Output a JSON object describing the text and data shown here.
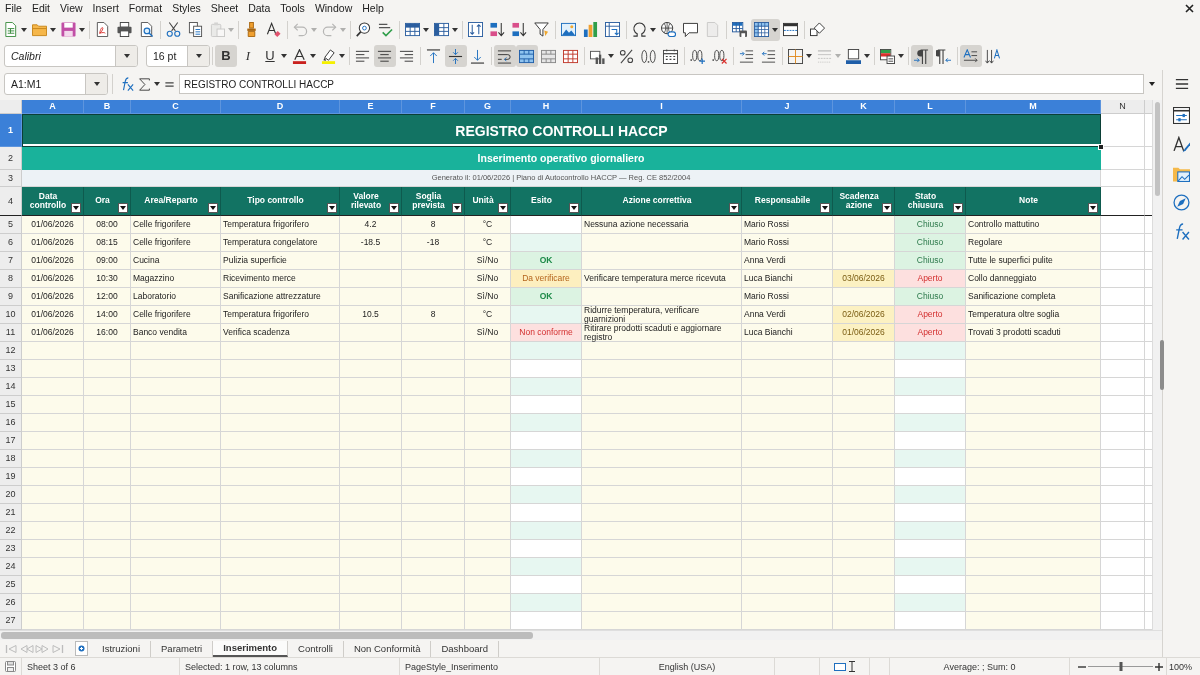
{
  "menu_bar": [
    "File",
    "Edit",
    "View",
    "Insert",
    "Format",
    "Styles",
    "Sheet",
    "Data",
    "Tools",
    "Window",
    "Help"
  ],
  "standard_toolbar": {
    "groups": [
      [
        {
          "kind": "new",
          "dropdown": true,
          "pressed": false,
          "disabled": false
        },
        {
          "kind": "open",
          "dropdown": true,
          "pressed": false,
          "disabled": false
        },
        {
          "kind": "save",
          "dropdown": true,
          "pressed": false,
          "disabled": false
        }
      ],
      [
        {
          "kind": "export_pdf",
          "dropdown": false,
          "pressed": false,
          "disabled": false
        },
        {
          "kind": "print",
          "dropdown": false,
          "pressed": false,
          "disabled": false
        },
        {
          "kind": "print_preview",
          "dropdown": false,
          "pressed": false,
          "disabled": false
        }
      ],
      [
        {
          "kind": "cut",
          "dropdown": false,
          "pressed": false,
          "disabled": false
        },
        {
          "kind": "copy",
          "dropdown": false,
          "pressed": false,
          "disabled": false
        },
        {
          "kind": "paste",
          "dropdown": true,
          "pressed": false,
          "disabled": true
        }
      ],
      [
        {
          "kind": "clone_format",
          "dropdown": false,
          "pressed": false,
          "disabled": false
        },
        {
          "kind": "clear_format",
          "dropdown": false,
          "pressed": false,
          "disabled": false
        }
      ],
      [
        {
          "kind": "undo",
          "dropdown": true,
          "pressed": false,
          "disabled": true
        },
        {
          "kind": "redo",
          "dropdown": true,
          "pressed": false,
          "disabled": true
        }
      ],
      [
        {
          "kind": "find_replace",
          "dropdown": false,
          "pressed": false,
          "disabled": false
        },
        {
          "kind": "spelling",
          "dropdown": false,
          "pressed": false,
          "disabled": false
        }
      ],
      [
        {
          "kind": "rows",
          "dropdown": true,
          "pressed": false,
          "disabled": false
        },
        {
          "kind": "columns",
          "dropdown": true,
          "pressed": false,
          "disabled": false
        }
      ],
      [
        {
          "kind": "sort",
          "dropdown": false,
          "pressed": false,
          "disabled": false
        },
        {
          "kind": "sort_ascending",
          "dropdown": false,
          "pressed": false,
          "disabled": false
        },
        {
          "kind": "sort_descending",
          "dropdown": false,
          "pressed": false,
          "disabled": false
        },
        {
          "kind": "autofilter",
          "dropdown": false,
          "pressed": false,
          "disabled": false
        }
      ],
      [
        {
          "kind": "image",
          "dropdown": false,
          "pressed": false,
          "disabled": false
        },
        {
          "kind": "chart",
          "dropdown": false,
          "pressed": false,
          "disabled": false
        },
        {
          "kind": "pivot_table",
          "dropdown": false,
          "pressed": false,
          "disabled": false
        }
      ],
      [
        {
          "kind": "special_character",
          "dropdown": true,
          "pressed": false,
          "disabled": false
        },
        {
          "kind": "hyperlink",
          "dropdown": false,
          "pressed": false,
          "disabled": false
        },
        {
          "kind": "comment",
          "dropdown": false,
          "pressed": false,
          "disabled": false
        },
        {
          "kind": "header_footer",
          "dropdown": false,
          "pressed": false,
          "disabled": true
        }
      ],
      [
        {
          "kind": "print_area",
          "dropdown": false,
          "pressed": false,
          "disabled": false
        },
        {
          "kind": "freeze",
          "dropdown": true,
          "pressed": true,
          "disabled": false
        },
        {
          "kind": "split_window",
          "dropdown": false,
          "pressed": false,
          "disabled": false
        }
      ],
      [
        {
          "kind": "draw_functions",
          "dropdown": false,
          "pressed": false,
          "disabled": false
        }
      ]
    ]
  },
  "formatting_toolbar": {
    "font_name": "Calibri",
    "font_size": "16 pt",
    "groups": [
      [
        {
          "kind": "bold",
          "label": "B",
          "dropdown": false,
          "pressed": true,
          "disabled": false
        },
        {
          "kind": "italic",
          "label": "I",
          "dropdown": false,
          "pressed": false,
          "disabled": false
        },
        {
          "kind": "underline",
          "label": "U",
          "dropdown": true,
          "pressed": false,
          "disabled": false
        },
        {
          "kind": "font_color",
          "dropdown": true,
          "pressed": false,
          "disabled": false
        },
        {
          "kind": "highlight",
          "dropdown": true,
          "pressed": false,
          "disabled": false
        }
      ],
      [
        {
          "kind": "align_left",
          "dropdown": false,
          "pressed": false,
          "disabled": false
        },
        {
          "kind": "align_center",
          "dropdown": false,
          "pressed": true,
          "disabled": false
        },
        {
          "kind": "align_right",
          "dropdown": false,
          "pressed": false,
          "disabled": false
        }
      ],
      [
        {
          "kind": "align_top",
          "dropdown": false,
          "pressed": false,
          "disabled": false
        },
        {
          "kind": "align_middle",
          "dropdown": false,
          "pressed": true,
          "disabled": false
        },
        {
          "kind": "align_bottom",
          "dropdown": false,
          "pressed": false,
          "disabled": false
        }
      ],
      [
        {
          "kind": "wrap_text",
          "dropdown": false,
          "pressed": true,
          "disabled": false
        },
        {
          "kind": "merge_center",
          "dropdown": false,
          "pressed": true,
          "disabled": false
        },
        {
          "kind": "merge_cells",
          "dropdown": false,
          "pressed": false,
          "disabled": false
        },
        {
          "kind": "unmerge_cells",
          "dropdown": false,
          "pressed": false,
          "disabled": false
        }
      ],
      [
        {
          "kind": "number_format",
          "dropdown": true,
          "pressed": false,
          "disabled": false
        },
        {
          "kind": "percent",
          "dropdown": false,
          "pressed": false,
          "disabled": false
        },
        {
          "kind": "decimal_format",
          "dropdown": false,
          "pressed": false,
          "disabled": false
        },
        {
          "kind": "date_format",
          "dropdown": false,
          "pressed": false,
          "disabled": false
        }
      ],
      [
        {
          "kind": "add_decimal",
          "dropdown": false,
          "pressed": false,
          "disabled": false
        },
        {
          "kind": "delete_decimal",
          "dropdown": false,
          "pressed": false,
          "disabled": false
        }
      ],
      [
        {
          "kind": "increase_indent",
          "dropdown": false,
          "pressed": false,
          "disabled": false
        },
        {
          "kind": "decrease_indent",
          "dropdown": false,
          "pressed": false,
          "disabled": false
        }
      ],
      [
        {
          "kind": "borders",
          "dropdown": true,
          "pressed": false,
          "disabled": false
        },
        {
          "kind": "border_style",
          "dropdown": true,
          "pressed": false,
          "disabled": true
        },
        {
          "kind": "border_color",
          "dropdown": true,
          "pressed": false,
          "disabled": false
        }
      ],
      [
        {
          "kind": "conditional_format",
          "dropdown": true,
          "pressed": false,
          "disabled": false
        }
      ],
      [
        {
          "kind": "left_to_right",
          "dropdown": false,
          "pressed": true,
          "disabled": false
        },
        {
          "kind": "right_to_left",
          "dropdown": false,
          "pressed": false,
          "disabled": false
        }
      ],
      [
        {
          "kind": "text_flow",
          "dropdown": false,
          "pressed": true,
          "disabled": false
        },
        {
          "kind": "sort_vertical",
          "dropdown": false,
          "pressed": false,
          "disabled": false
        }
      ]
    ]
  },
  "formula_bar": {
    "name_box": "A1:M1",
    "formula": "REGISTRO CONTROLLI HACCP"
  },
  "sheet": {
    "column_headers": [
      {
        "label": "A",
        "selected": true
      },
      {
        "label": "B",
        "selected": true
      },
      {
        "label": "C",
        "selected": true
      },
      {
        "label": "D",
        "selected": true
      },
      {
        "label": "E",
        "selected": true
      },
      {
        "label": "F",
        "selected": true
      },
      {
        "label": "G",
        "selected": true
      },
      {
        "label": "H",
        "selected": true
      },
      {
        "label": "I",
        "selected": true
      },
      {
        "label": "J",
        "selected": true
      },
      {
        "label": "K",
        "selected": true
      },
      {
        "label": "L",
        "selected": true
      },
      {
        "label": "M",
        "selected": true
      },
      {
        "label": "N",
        "selected": false
      }
    ],
    "row_headers": [
      {
        "label": "1",
        "selected": true
      },
      {
        "label": "2",
        "selected": false
      },
      {
        "label": "3",
        "selected": false
      },
      {
        "label": "4",
        "selected": false
      },
      {
        "label": "5",
        "selected": false
      },
      {
        "label": "6",
        "selected": false
      },
      {
        "label": "7",
        "selected": false
      },
      {
        "label": "8",
        "selected": false
      },
      {
        "label": "9",
        "selected": false
      },
      {
        "label": "10",
        "selected": false
      },
      {
        "label": "11",
        "selected": false
      },
      {
        "label": "12",
        "selected": false
      },
      {
        "label": "13",
        "selected": false
      },
      {
        "label": "14",
        "selected": false
      },
      {
        "label": "15",
        "selected": false
      },
      {
        "label": "16",
        "selected": false
      },
      {
        "label": "17",
        "selected": false
      },
      {
        "label": "18",
        "selected": false
      },
      {
        "label": "19",
        "selected": false
      },
      {
        "label": "20",
        "selected": false
      },
      {
        "label": "21",
        "selected": false
      },
      {
        "label": "22",
        "selected": false
      },
      {
        "label": "23",
        "selected": false
      },
      {
        "label": "24",
        "selected": false
      },
      {
        "label": "25",
        "selected": false
      },
      {
        "label": "26",
        "selected": false
      },
      {
        "label": "27",
        "selected": false
      }
    ],
    "title": "REGISTRO CONTROLLI HACCP",
    "subtitle": "Inserimento operativo giornaliero",
    "info": "Generato il: 01/06/2026 | Piano di Autocontrollo HACCP — Reg. CE 852/2004",
    "columns": [
      "Data controllo",
      "Ora",
      "Area/Reparto",
      "Tipo controllo",
      "Valore rilevato",
      "Soglia prevista",
      "Unità",
      "Esito",
      "Azione correttiva",
      "Responsabile",
      "Scadenza azione",
      "Stato chiusura",
      "Note"
    ],
    "rows": [
      {
        "date": "01/06/2026",
        "time": "08:00",
        "area": "Celle frigorifere",
        "check_type": "Temperatura frigorifero",
        "measured_value": "4.2",
        "threshold": "8",
        "unit": "°C",
        "corrective_action": "Nessuna azione necessaria",
        "owner": "Mario Rossi",
        "closure": {
          "text": "Chiuso",
          "kind": "closed"
        },
        "notes": "Controllo mattutino"
      },
      {
        "date": "01/06/2026",
        "time": "08:15",
        "area": "Celle frigorifere",
        "check_type": "Temperatura congelatore",
        "measured_value": "-18.5",
        "threshold": "-18",
        "unit": "°C",
        "owner": "Mario Rossi",
        "closure": {
          "text": "Chiuso",
          "kind": "closed"
        },
        "notes": "Regolare"
      },
      {
        "date": "01/06/2026",
        "time": "09:00",
        "area": "Cucina",
        "check_type": "Pulizia superficie",
        "unit": "Sì/No",
        "outcome": {
          "text": "OK",
          "kind": "ok"
        },
        "owner": "Anna Verdi",
        "closure": {
          "text": "Chiuso",
          "kind": "closed"
        },
        "notes": "Tutte le superfici pulite"
      },
      {
        "date": "01/06/2026",
        "time": "10:30",
        "area": "Magazzino",
        "check_type": "Ricevimento merce",
        "unit": "Sì/No",
        "outcome": {
          "text": "Da verificare",
          "kind": "check"
        },
        "corrective_action": "Verificare temperatura merce ricevuta",
        "owner": "Luca Bianchi",
        "action_due": "03/06/2026",
        "closure": {
          "text": "Aperto",
          "kind": "open"
        },
        "notes": "Collo danneggiato"
      },
      {
        "date": "01/06/2026",
        "time": "12:00",
        "area": "Laboratorio",
        "check_type": "Sanificazione attrezzature",
        "unit": "Sì/No",
        "outcome": {
          "text": "OK",
          "kind": "ok"
        },
        "owner": "Mario Rossi",
        "closure": {
          "text": "Chiuso",
          "kind": "closed"
        },
        "notes": "Sanificazione completa"
      },
      {
        "date": "01/06/2026",
        "time": "14:00",
        "area": "Celle frigorifere",
        "check_type": "Temperatura frigorifero",
        "measured_value": "10.5",
        "threshold": "8",
        "unit": "°C",
        "corrective_action": "Ridurre temperatura, verificare guarnizioni",
        "owner": "Anna Verdi",
        "action_due": "02/06/2026",
        "closure": {
          "text": "Aperto",
          "kind": "open"
        },
        "notes": "Temperatura oltre soglia"
      },
      {
        "date": "01/06/2026",
        "time": "16:00",
        "area": "Banco vendita",
        "check_type": "Verifica scadenza",
        "unit": "Sì/No",
        "outcome": {
          "text": "Non conforme",
          "kind": "nonconforming"
        },
        "corrective_action": "Ritirare prodotti scaduti e aggiornare registro",
        "owner": "Luca Bianchi",
        "action_due": "01/06/2026",
        "closure": {
          "text": "Aperto",
          "kind": "open"
        },
        "notes": "Trovati 3 prodotti scaduti"
      }
    ]
  },
  "sheet_tabs": {
    "navigation": {
      "disabled": true
    },
    "tabs": [
      {
        "label": "Istruzioni",
        "selected": false
      },
      {
        "label": "Parametri",
        "selected": false
      },
      {
        "label": "Inserimento",
        "selected": true
      },
      {
        "label": "Controlli",
        "selected": false
      },
      {
        "label": "Non Conformità",
        "selected": false
      },
      {
        "label": "Dashboard",
        "selected": false
      }
    ]
  },
  "status_bar": {
    "sheet": "Sheet 3 of 6",
    "selection": "Selected: 1 row, 13 columns",
    "page_style": "PageStyle_Inserimento",
    "language": "English (USA)",
    "summary": "Average: ; Sum: 0",
    "zoom": {
      "level": 0.5,
      "label": "100%"
    }
  }
}
